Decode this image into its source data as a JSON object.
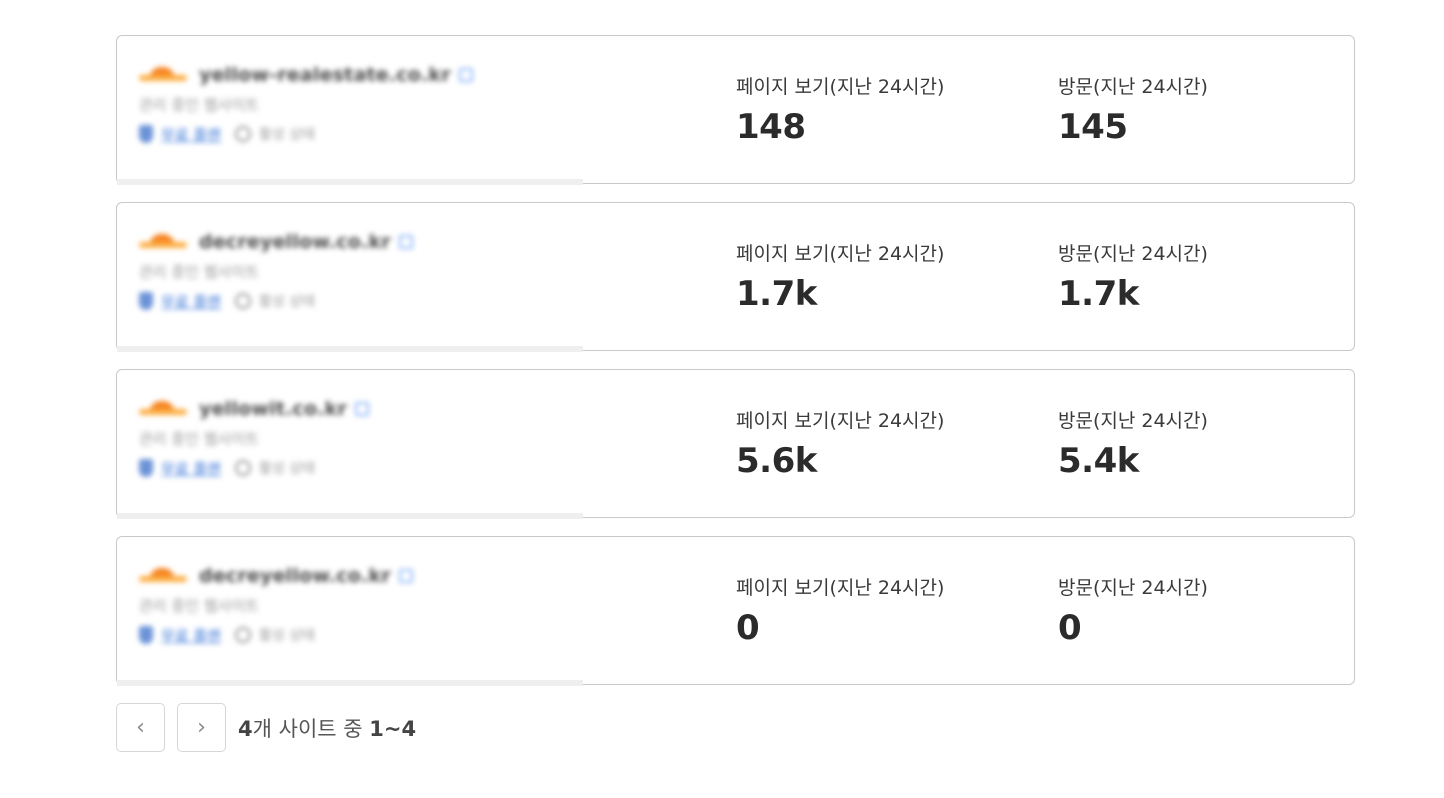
{
  "sites": [
    {
      "domain": "yellow-realestate.co.kr",
      "subtitle": "관리 중인 웹사이트",
      "plan": "무료 플랜",
      "meta": "활성 상태",
      "views_label": "페이지 보기(지난 24시간)",
      "views": "148",
      "visits_label": "방문(지난 24시간)",
      "visits": "145"
    },
    {
      "domain": "decreyellow.co.kr",
      "subtitle": "관리 중인 웹사이트",
      "plan": "무료 플랜",
      "meta": "활성 상태",
      "views_label": "페이지 보기(지난 24시간)",
      "views": "1.7k",
      "visits_label": "방문(지난 24시간)",
      "visits": "1.7k"
    },
    {
      "domain": "yellowit.co.kr",
      "subtitle": "관리 중인 웹사이트",
      "plan": "무료 플랜",
      "meta": "활성 상태",
      "views_label": "페이지 보기(지난 24시간)",
      "views": "5.6k",
      "visits_label": "방문(지난 24시간)",
      "visits": "5.4k"
    },
    {
      "domain": "decreyellow.co.kr",
      "subtitle": "관리 중인 웹사이트",
      "plan": "무료 플랜",
      "meta": "활성 상태",
      "views_label": "페이지 보기(지난 24시간)",
      "views": "0",
      "visits_label": "방문(지난 24시간)",
      "visits": "0"
    }
  ],
  "pagination": {
    "prev_glyph": "‹",
    "next_glyph": "›",
    "total": "4",
    "summary_mid": "개 사이트 중 ",
    "range": "1~4"
  }
}
